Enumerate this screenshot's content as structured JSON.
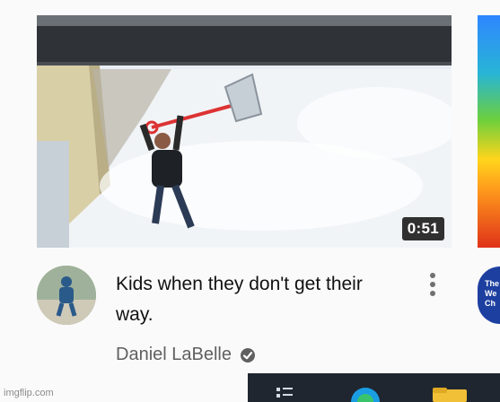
{
  "video": {
    "duration": "0:51",
    "title": "Kids when they don't get their way.",
    "channel": "Daniel LaBelle",
    "verified_icon": "verified-check-icon",
    "menu_icon": "more-vertical-icon"
  },
  "next_video": {
    "avatar_text": "The We Ch"
  },
  "taskbar": {
    "icons": [
      "task-view-icon",
      "edge-browser-icon",
      "file-explorer-icon"
    ]
  },
  "watermark": "imgflip.com"
}
